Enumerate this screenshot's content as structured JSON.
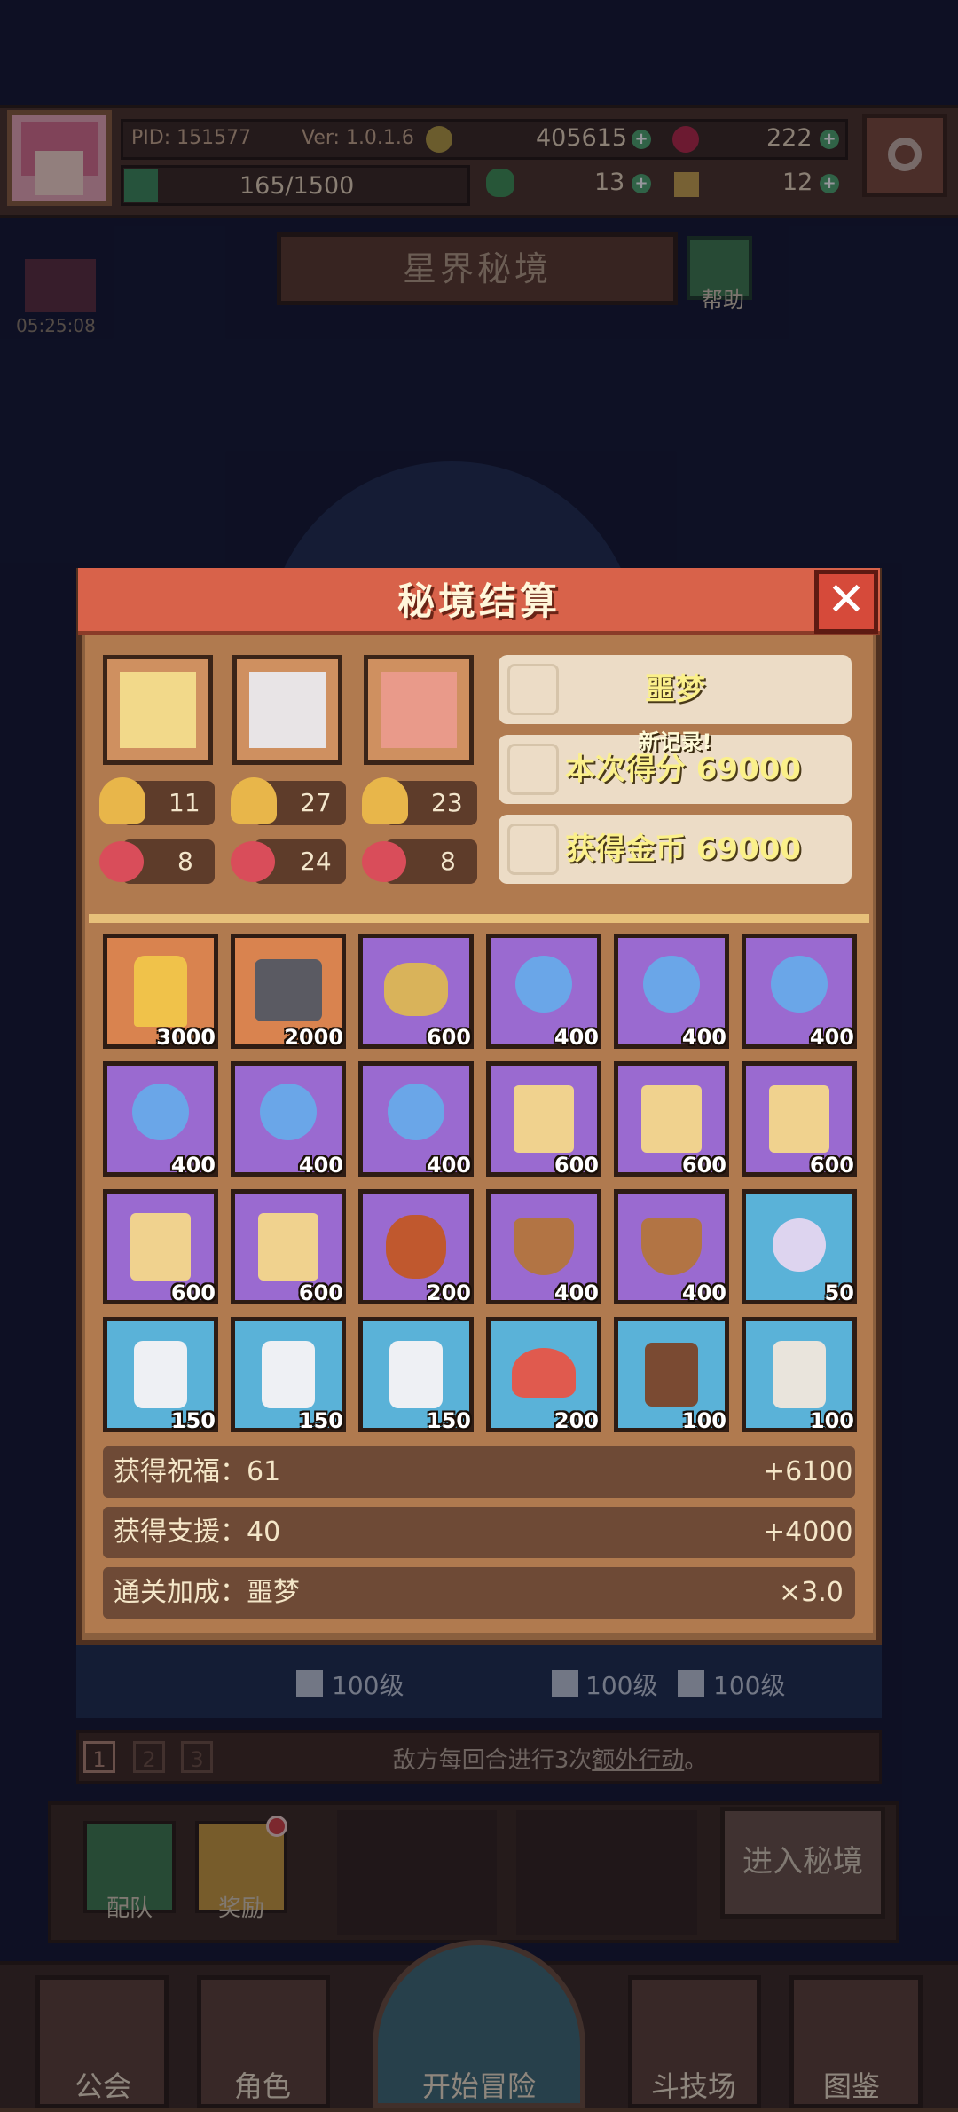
{
  "top_bar": {
    "pid": "PID: 151577",
    "version": "Ver: 1.0.1.6",
    "gold": "405615",
    "gems": "222",
    "stamina": "165/1500",
    "clover": "13",
    "key": "12"
  },
  "page": {
    "title": "星界秘境",
    "help_label": "帮助",
    "timer": "05:25:08"
  },
  "background_ui": {
    "levels": [
      "100级",
      "100级",
      "100级"
    ],
    "modifier_tabs": [
      "1",
      "2",
      "3"
    ],
    "modifier_text_pre": "敌方每回合进行3次",
    "modifier_text_link": "额外行动",
    "modifier_text_post": "。",
    "team_label": "配队",
    "reward_label": "奖励",
    "enter_label": "进入秘境"
  },
  "nav": {
    "guild": "公会",
    "character": "角色",
    "adventure": "开始冒险",
    "arena": "斗技场",
    "codex": "图鉴"
  },
  "modal": {
    "title": "秘境结算",
    "close": "✕",
    "difficulty": "噩梦",
    "new_record": "新记录!",
    "score_label": "本次得分 69000",
    "gold_label": "获得金币 69000",
    "heroes": [
      {
        "name": "hero-blonde",
        "trophies": "11",
        "bears": "8"
      },
      {
        "name": "hero-white",
        "trophies": "27",
        "bears": "24"
      },
      {
        "name": "hero-pink",
        "trophies": "23",
        "bears": "8"
      }
    ],
    "items": [
      {
        "icon": "golden-warrior-icon",
        "color": "orange",
        "qty": "3000"
      },
      {
        "icon": "iron-chest-icon",
        "color": "orange",
        "qty": "2000"
      },
      {
        "icon": "telescope-icon",
        "color": "purple",
        "qty": "600"
      },
      {
        "icon": "crystal-orb-icon",
        "color": "purple",
        "qty": "400"
      },
      {
        "icon": "crystal-orb-icon",
        "color": "purple",
        "qty": "400"
      },
      {
        "icon": "crystal-orb-icon",
        "color": "purple",
        "qty": "400"
      },
      {
        "icon": "crystal-orb-icon",
        "color": "purple",
        "qty": "400"
      },
      {
        "icon": "crystal-orb-icon",
        "color": "purple",
        "qty": "400"
      },
      {
        "icon": "crystal-orb-icon",
        "color": "purple",
        "qty": "400"
      },
      {
        "icon": "scroll-icon",
        "color": "purple",
        "qty": "600"
      },
      {
        "icon": "scroll-icon",
        "color": "purple",
        "qty": "600"
      },
      {
        "icon": "scroll-icon",
        "color": "purple",
        "qty": "600"
      },
      {
        "icon": "scroll-icon",
        "color": "purple",
        "qty": "600"
      },
      {
        "icon": "scroll-icon",
        "color": "purple",
        "qty": "600"
      },
      {
        "icon": "treasure-bag-icon",
        "color": "purple",
        "qty": "200"
      },
      {
        "icon": "shield-piece-icon",
        "color": "purple",
        "qty": "400"
      },
      {
        "icon": "shield-piece-icon",
        "color": "purple",
        "qty": "400"
      },
      {
        "icon": "pearl-icon",
        "color": "blue",
        "qty": "50"
      },
      {
        "icon": "stone-tablet-icon",
        "color": "blue",
        "qty": "150"
      },
      {
        "icon": "stone-tablet-icon",
        "color": "blue",
        "qty": "150"
      },
      {
        "icon": "stone-tablet-icon",
        "color": "blue",
        "qty": "150"
      },
      {
        "icon": "mushroom-icon",
        "color": "blue",
        "qty": "200"
      },
      {
        "icon": "barrel-icon",
        "color": "blue",
        "qty": "100"
      },
      {
        "icon": "jar-icon",
        "color": "blue",
        "qty": "100"
      }
    ],
    "summary": [
      {
        "label": "获得祝福：61",
        "value": "+6100"
      },
      {
        "label": "获得支援：40",
        "value": "+4000"
      },
      {
        "label": "通关加成：噩梦",
        "value": "×3.0"
      }
    ]
  },
  "colors": {
    "orange_tile": "#d9834f",
    "purple_tile": "#9a6ad0",
    "blue_tile": "#5ab2d8",
    "header_red": "#d8624a",
    "highlight_yellow": "#fbf08a"
  }
}
